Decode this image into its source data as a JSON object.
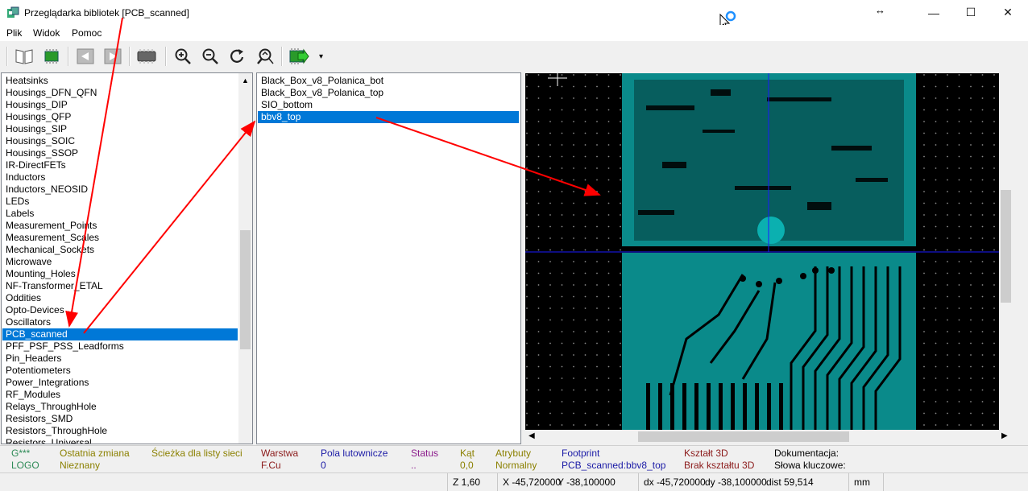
{
  "window": {
    "title": "Przeglądarka bibliotek [PCB_scanned]",
    "minimize": "—",
    "maximize": "☐",
    "close": "✕",
    "resize_glyph": "↔"
  },
  "menu": [
    "Plik",
    "Widok",
    "Pomoc"
  ],
  "toolbar": {
    "icons": [
      "library-book-icon",
      "footprint-chip-icon",
      "prev-arrow-icon",
      "next-arrow-icon",
      "3d-view-icon",
      "zoom-in-icon",
      "zoom-out-icon",
      "redraw-icon",
      "zoom-fit-icon",
      "insert-footprint-icon"
    ],
    "dropdown_glyph": "▾"
  },
  "libraries": {
    "items": [
      "Heatsinks",
      "Housings_DFN_QFN",
      "Housings_DIP",
      "Housings_QFP",
      "Housings_SIP",
      "Housings_SOIC",
      "Housings_SSOP",
      "IR-DirectFETs",
      "Inductors",
      "Inductors_NEOSID",
      "LEDs",
      "Labels",
      "Measurement_Points",
      "Measurement_Scales",
      "Mechanical_Sockets",
      "Microwave",
      "Mounting_Holes",
      "NF-Transformer_ETAL",
      "Oddities",
      "Opto-Devices",
      "Oscillators",
      "PCB_scanned",
      "PFF_PSF_PSS_Leadforms",
      "Pin_Headers",
      "Potentiometers",
      "Power_Integrations",
      "RF_Modules",
      "Relays_ThroughHole",
      "Resistors_SMD",
      "Resistors_ThroughHole",
      "Resistors_Universal"
    ],
    "selected_index": 21
  },
  "footprints": {
    "items": [
      "Black_Box_v8_Polanica_bot",
      "Black_Box_v8_Polanica_top",
      "SIO_bottom",
      "bbv8_top"
    ],
    "selected_index": 3
  },
  "status": {
    "col1": {
      "h": "G***",
      "v": "LOGO",
      "color": "#2e8b57"
    },
    "col2": {
      "h": "Ostatnia zmiana",
      "v": "Nieznany",
      "color": "#8b8000"
    },
    "col3": {
      "h": "Ścieżka dla listy sieci",
      "v": "",
      "color": "#8b8000"
    },
    "col4": {
      "h": "Warstwa",
      "v": "F.Cu",
      "color": "#8b1a1a"
    },
    "col5": {
      "h": "Pola lutownicze",
      "v": "0",
      "color": "#1a1aa6"
    },
    "col6": {
      "h": "Status",
      "v": "..",
      "color": "#8b1a8b"
    },
    "col7": {
      "h": "Kąt",
      "v": "0,0",
      "color": "#8b8000"
    },
    "col8": {
      "h": "Atrybuty",
      "v": "Normalny",
      "color": "#8b8000"
    },
    "col9": {
      "h": "Footprint",
      "v": "PCB_scanned:bbv8_top",
      "color": "#1a1aa6"
    },
    "col10": {
      "h": "Kształt 3D",
      "v": "Brak kształtu 3D",
      "color": "#8b1a1a"
    },
    "col11": {
      "h": "Dokumentacja:",
      "v": "Słowa kluczowe:",
      "color": "#000000"
    }
  },
  "bottom": {
    "zoom": "Z 1,60",
    "x": "X -45,720000",
    "y": "Y -38,100000",
    "dx": "dx -45,720000",
    "dy": "dy -38,100000",
    "dist": "dist 59,514",
    "units": "mm"
  },
  "colors": {
    "accent": "#0078d7",
    "pcb_copper": "#008b8b",
    "arrow": "#ff0000"
  }
}
